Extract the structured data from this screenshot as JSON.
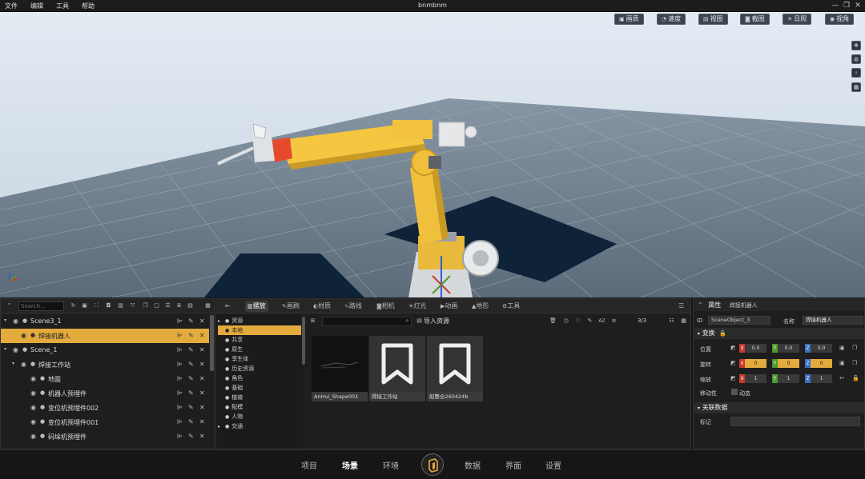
{
  "menubar": {
    "items": [
      "文件",
      "编辑",
      "工具",
      "帮助"
    ],
    "title": "bnmbnm"
  },
  "viewport": {
    "toolbar": [
      {
        "icon": "image-icon",
        "label": "画质"
      },
      {
        "icon": "speed-icon",
        "label": "速度"
      },
      {
        "icon": "view-icon",
        "label": "视图"
      },
      {
        "icon": "screenshot-icon",
        "label": "截图"
      },
      {
        "icon": "sun-icon",
        "label": "日照"
      },
      {
        "icon": "eye-icon",
        "label": "视角"
      }
    ],
    "side_tools": [
      "move-icon",
      "globe-icon",
      "person-icon",
      "grid-icon"
    ]
  },
  "outliner": {
    "search_placeholder": "Search...",
    "rows": [
      {
        "label": "Scene3_1",
        "level": 0,
        "expanded": true
      },
      {
        "label": "焊接机器人",
        "level": 1,
        "selected": true
      },
      {
        "label": "Scene_1",
        "level": 0,
        "expanded": true
      },
      {
        "label": "焊接工作站",
        "level": 1,
        "expanded": true
      },
      {
        "label": "地面",
        "level": 2
      },
      {
        "label": "机器人预埋件",
        "level": 2
      },
      {
        "label": "变位机预埋件002",
        "level": 2
      },
      {
        "label": "变位机预埋件001",
        "level": 2
      },
      {
        "label": "码垛机预埋件",
        "level": 2
      }
    ]
  },
  "assets": {
    "tabs": [
      {
        "icon": "place-icon",
        "label": "摆放"
      },
      {
        "icon": "brush-icon",
        "label": "画刷"
      },
      {
        "icon": "material-icon",
        "label": "材质"
      },
      {
        "icon": "path-icon",
        "label": "路线"
      },
      {
        "icon": "camera-icon",
        "label": "相机"
      },
      {
        "icon": "light-icon",
        "label": "灯光"
      },
      {
        "icon": "animation-icon",
        "label": "动画"
      },
      {
        "icon": "terrain-icon",
        "label": "地形"
      },
      {
        "icon": "tools-icon",
        "label": "工具"
      }
    ],
    "tree": [
      {
        "label": "资源",
        "arrow": "▸"
      },
      {
        "label": "本地",
        "selected": true
      },
      {
        "label": "共享"
      },
      {
        "label": "原生"
      },
      {
        "label": "孪生体"
      },
      {
        "label": "历史资源"
      },
      {
        "label": "角色"
      },
      {
        "label": "基础"
      },
      {
        "label": "植被"
      },
      {
        "label": "配模"
      },
      {
        "label": "人物"
      },
      {
        "label": "交通",
        "arrow": "▸"
      }
    ],
    "import_label": "导入资源",
    "count": "3/3",
    "cards": [
      {
        "name": "AnHui_Shape001",
        "kind": "mesh"
      },
      {
        "name": "焊接工作站",
        "kind": "bookmark"
      },
      {
        "name": "船整合260424b",
        "kind": "bookmark"
      }
    ]
  },
  "props": {
    "title": "属性",
    "subtitle": "焊接机器人",
    "id_label": "ID",
    "id_value": "SceneObject_3",
    "name_label": "名称",
    "name_value": "焊接机器人",
    "transform_label": "变换",
    "rows": [
      {
        "label": "位置",
        "x": "0.0",
        "y": "0.0",
        "z": "0.0",
        "hl": false
      },
      {
        "label": "旋转",
        "x": "0",
        "y": "0",
        "z": "0",
        "hl": true
      },
      {
        "label": "缩放",
        "x": "1",
        "y": "1",
        "z": "1",
        "hl": false
      }
    ],
    "mobility_label": "移动性",
    "mobility_value": "动态",
    "related_label": "关联数据",
    "tag_label": "标记"
  },
  "bottom": {
    "items": [
      "项目",
      "场景",
      "环境",
      "数据",
      "界面",
      "设置"
    ],
    "active": "场景"
  },
  "colors": {
    "accent": "#e3aa3d",
    "sky_top": "#d6e1ec",
    "floor": "#687888"
  }
}
